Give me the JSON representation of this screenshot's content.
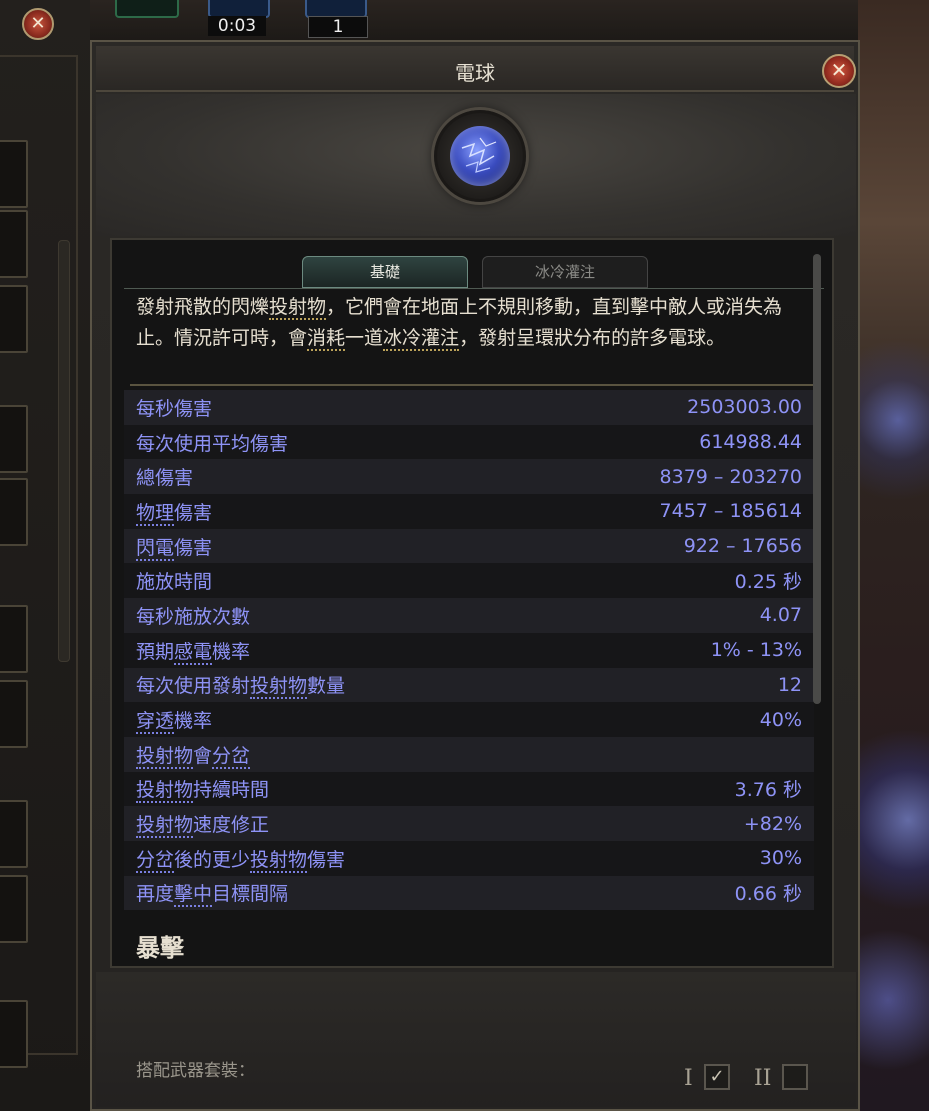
{
  "hud": {
    "timer": "0:03",
    "count": "1"
  },
  "dialog": {
    "title": "電球",
    "close_icon": "close-icon"
  },
  "tabs": [
    {
      "label": "基礎",
      "active": true
    },
    {
      "label": "冰冷灌注",
      "active": false
    }
  ],
  "description": {
    "p1": "發射飛散的閃爍",
    "u1": "投射物",
    "p2": "，它們會在地面上不規則移動，直到擊中敵人或消失為止。情況許可時，會",
    "u2": "消耗",
    "p3": "一道",
    "u3": "冰冷灌注",
    "p4": "，發射呈環狀分布的許多電球。"
  },
  "stats": [
    {
      "label": "每秒傷害",
      "value": "2503003.00"
    },
    {
      "label": "每次使用平均傷害",
      "value": "614988.44"
    },
    {
      "label": "總傷害",
      "value": "8379 – 203270"
    },
    {
      "label_pre": "",
      "label_u": "物理",
      "label_post": "傷害",
      "value": "7457 – 185614"
    },
    {
      "label_pre": "",
      "label_u": "閃電",
      "label_post": "傷害",
      "value": "922 – 17656"
    },
    {
      "label": "施放時間",
      "value": "0.25 秒"
    },
    {
      "label": "每秒施放次數",
      "value": "4.07"
    },
    {
      "label_pre": "預期",
      "label_u": "感電",
      "label_post": "機率",
      "value": "1% - 13%"
    },
    {
      "label_pre": "每次使用發射",
      "label_u": "投射物",
      "label_post": "數量",
      "value": "12"
    },
    {
      "label_pre": "",
      "label_u": "穿透",
      "label_post": "機率",
      "value": "40%"
    },
    {
      "label_pre": "",
      "label_u": "投射物",
      "label_post": "會",
      "label_u2": "分岔",
      "value": ""
    },
    {
      "label_pre": "",
      "label_u": "投射物",
      "label_post": "持續時間",
      "value": "3.76 秒"
    },
    {
      "label_pre": "",
      "label_u": "投射物",
      "label_post": "速度修正",
      "value": "+82%"
    },
    {
      "label_pre": "",
      "label_u": "分岔",
      "label_post": "後的更少",
      "label_u2": "投射物",
      "label_post2": "傷害",
      "value": "30%"
    },
    {
      "label_pre": "再度",
      "label_u": "擊中",
      "label_post": "目標間隔",
      "value": "0.66 秒"
    }
  ],
  "section_title": "暴擊",
  "equip": {
    "label": "搭配武器套裝：",
    "set1": "I",
    "set2": "II",
    "set1_checked": true,
    "set2_checked": false,
    "check_mark": "✓"
  },
  "colors": {
    "stat_text": "#8e93f6",
    "desc_text": "#e6dfd0",
    "close_button": "#c8563e"
  }
}
